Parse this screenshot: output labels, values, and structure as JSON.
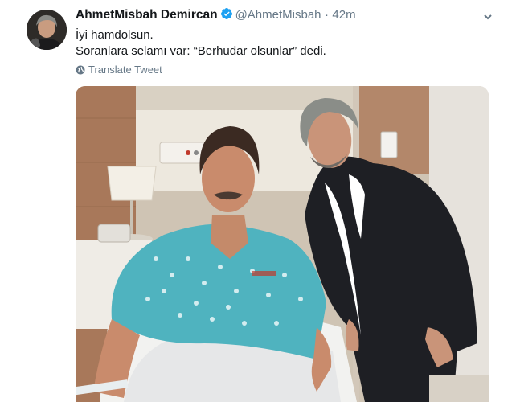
{
  "tweet": {
    "author": {
      "display_name": "AhmetMisbah Demircan",
      "handle": "@AhmetMisbah",
      "verified_icon": "verified-badge-icon",
      "avatar_icon": "avatar-portrait"
    },
    "separator": "·",
    "time": "42m",
    "lines": [
      "İyi hamdolsun.",
      "Soranlara selamı var: “Berhudar olsunlar” dedi."
    ],
    "translate_label": "Translate Tweet",
    "menu_icon": "chevron-down-icon",
    "photo": {
      "description_icon": "hospital-room-photo"
    },
    "colors": {
      "text": "#14171a",
      "muted": "#657786",
      "verified": "#1da1f2",
      "gown": "#4fb3bf",
      "suit": "#1e1f24",
      "wall_wood": "#a8785a"
    }
  }
}
